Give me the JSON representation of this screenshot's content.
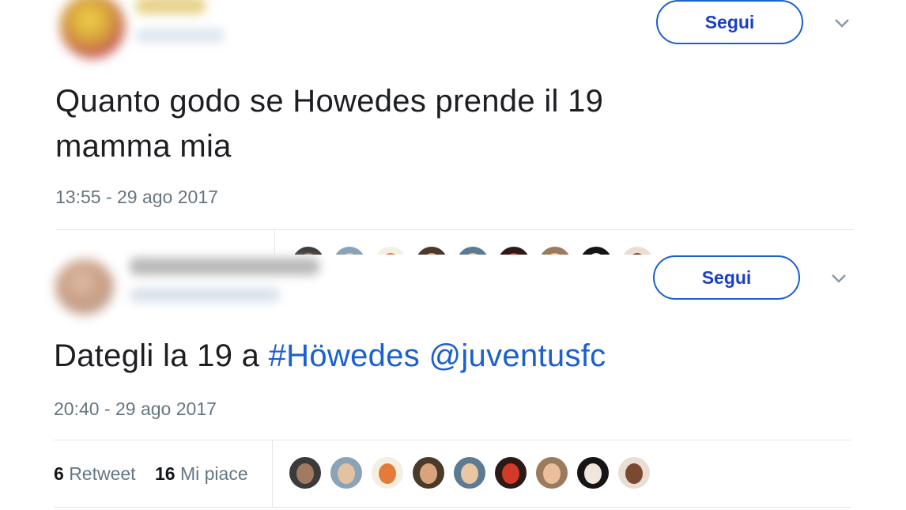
{
  "tweets": [
    {
      "follow_label": "Segui",
      "text": "Quanto godo se Howedes prende il 19",
      "text_line2": "mamma mia",
      "timestamp": "13:55 - 29 ago 2017",
      "avatar_color": "#d6a23c"
    },
    {
      "follow_label": "Segui",
      "text_prefix": "Dategli la 19 a ",
      "hashtag": "#Höwedes",
      "mention": "@juventusfc",
      "timestamp": "20:40 - 29 ago 2017",
      "retweet_count": "6",
      "retweet_label": "Retweet",
      "like_count": "16",
      "like_label": "Mi piace",
      "avatar_color": "#c59a82"
    }
  ],
  "colors": {
    "link": "#1b5fd0",
    "follow_border": "#1b5fd0",
    "follow_text": "#1b3fc4",
    "meta_text": "#66757f"
  },
  "liker_avatars": [
    {
      "bg": "#3b3b3b",
      "face": "#a07b62"
    },
    {
      "bg": "#8aa3b8",
      "face": "#e2c2a2"
    },
    {
      "bg": "#f3efe2",
      "face": "#e57b3a"
    },
    {
      "bg": "#4a3a2a",
      "face": "#d8a47e"
    },
    {
      "bg": "#5d7a93",
      "face": "#e9c7a1"
    },
    {
      "bg": "#2b1a16",
      "face": "#d23a2a"
    },
    {
      "bg": "#9a7b5d",
      "face": "#ebbf9c"
    },
    {
      "bg": "#151515",
      "face": "#f0e6dc"
    },
    {
      "bg": "#e9ddd4",
      "face": "#7a4a30"
    }
  ]
}
